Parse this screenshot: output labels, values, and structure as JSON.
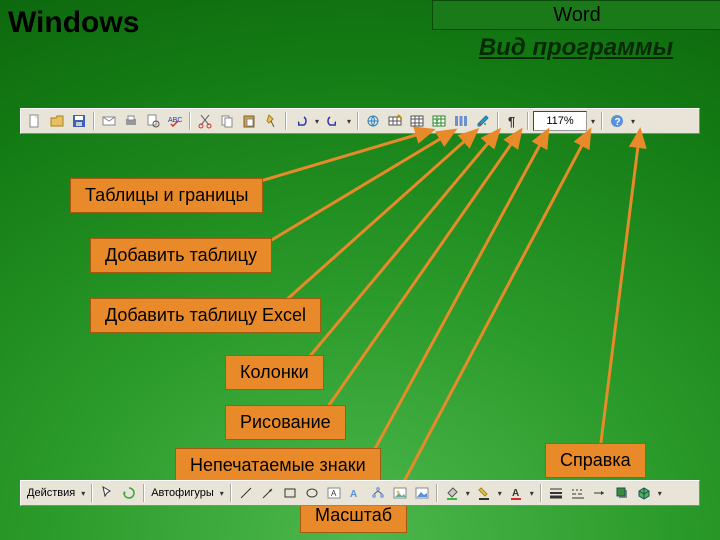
{
  "header": {
    "windows": "Windows",
    "word": "Word",
    "subtitle": "Вид программы"
  },
  "toolbar_top": {
    "zoom_value": "117%"
  },
  "toolbar_bottom": {
    "actions_label": "Действия",
    "autoshapes_label": "Автофигуры"
  },
  "annotations": {
    "tables_borders": "Таблицы и границы",
    "insert_table": "Добавить таблицу",
    "insert_excel": "Добавить таблицу Excel",
    "columns": "Колонки",
    "drawing": "Рисование",
    "nonprint": "Непечатаемые знаки",
    "zoom": "Масштаб",
    "help": "Справка"
  },
  "icons": {
    "new": "new",
    "open": "open",
    "save": "save",
    "mail": "mail",
    "print": "print",
    "preview": "preview",
    "spell": "spell",
    "cut": "cut",
    "copy": "copy",
    "paste": "paste",
    "format": "format",
    "undo": "undo",
    "redo": "redo",
    "link": "link",
    "tbborders": "tbborders",
    "inserttable": "inserttable",
    "excel": "excel",
    "columns": "columns",
    "drawing": "drawing",
    "paragraph": "paragraph",
    "help": "help",
    "select": "select",
    "rotate": "rotate",
    "line": "line",
    "arrow": "arrow",
    "rect": "rect",
    "oval": "oval",
    "text": "text",
    "wordart": "wordart",
    "diagram": "diagram",
    "clipart": "clipart",
    "picture": "picture",
    "fill": "fill",
    "linecolor": "linecolor",
    "fontcolor": "fontcolor",
    "lineweight": "lineweight",
    "dash": "dash",
    "arrowstyle": "arrowstyle",
    "shadow": "shadow",
    "threed": "threed"
  }
}
